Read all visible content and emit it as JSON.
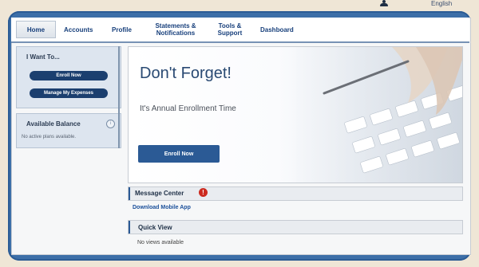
{
  "topbar": {
    "language_label": "English"
  },
  "nav": {
    "items": [
      "Home",
      "Accounts",
      "Profile",
      "Statements & Notifications",
      "Tools & Support",
      "Dashboard"
    ]
  },
  "left": {
    "iwant_title": "I Want To...",
    "enroll_label": "Enroll Now",
    "manage_label": "Manage My Expenses",
    "available_title": "Available Balance",
    "available_empty": "No active plans available."
  },
  "hero": {
    "title": "Don't Forget!",
    "subtitle": "It's Annual Enrollment Time",
    "button_label": "Enroll Now"
  },
  "message_center": {
    "title": "Message Center",
    "alert_glyph": "!",
    "link": "Download Mobile App"
  },
  "quick_view": {
    "title": "Quick View",
    "empty": "No views available"
  },
  "icons": {
    "user": "user-icon",
    "info": "info-icon",
    "alert": "alert-icon"
  },
  "colors": {
    "frame": "#3d6fa8",
    "nav_text": "#173f7b",
    "button_dark": "#1b3f6f",
    "hero_button": "#2b5a95",
    "alert": "#cc2a1f"
  }
}
